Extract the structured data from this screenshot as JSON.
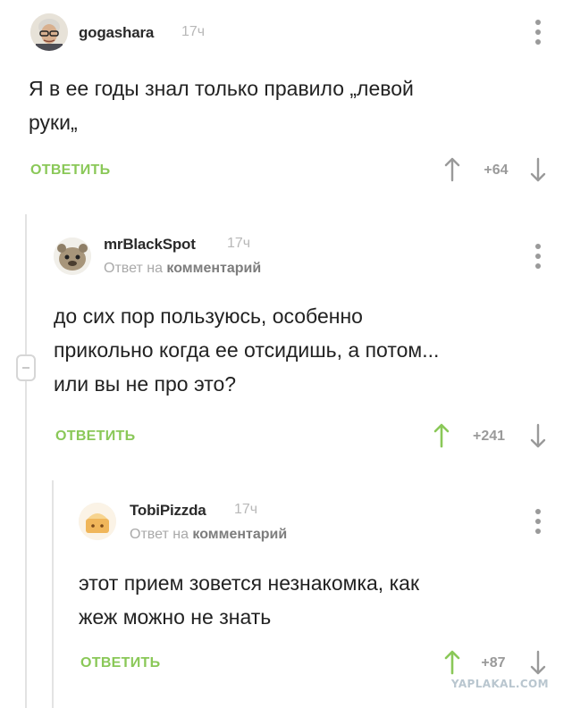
{
  "comments": [
    {
      "username": "gogashara",
      "time": "17ч",
      "text_lines": [
        "Я в ее годы знал только правило „левой",
        "руки„"
      ],
      "reply_label": "ОТВЕТИТЬ",
      "rating": "+64",
      "upvoted": false
    },
    {
      "username": "mrBlackSpot",
      "time": "17ч",
      "reply_to_prefix": "Ответ на",
      "reply_to_link": "комментарий",
      "text_lines": [
        "до сих пор пользуюсь, особенно",
        "прикольно когда ее отсидишь, а потом...",
        "или вы не про это?"
      ],
      "reply_label": "ОТВЕТИТЬ",
      "rating": "+241",
      "upvoted": true
    },
    {
      "username": "TobiPizzda",
      "time": "17ч",
      "reply_to_prefix": "Ответ на",
      "reply_to_link": "комментарий",
      "text_lines": [
        "этот прием зовется незнакомка, как",
        "жеж можно не знать"
      ],
      "reply_label": "ОТВЕТИТЬ",
      "rating": "+87",
      "upvoted": true
    }
  ],
  "watermark": "YAPLAKAL.COM",
  "colors": {
    "accent_green": "#8ac858",
    "muted": "#9a9a9a",
    "branch_line": "#e3e3e3"
  }
}
